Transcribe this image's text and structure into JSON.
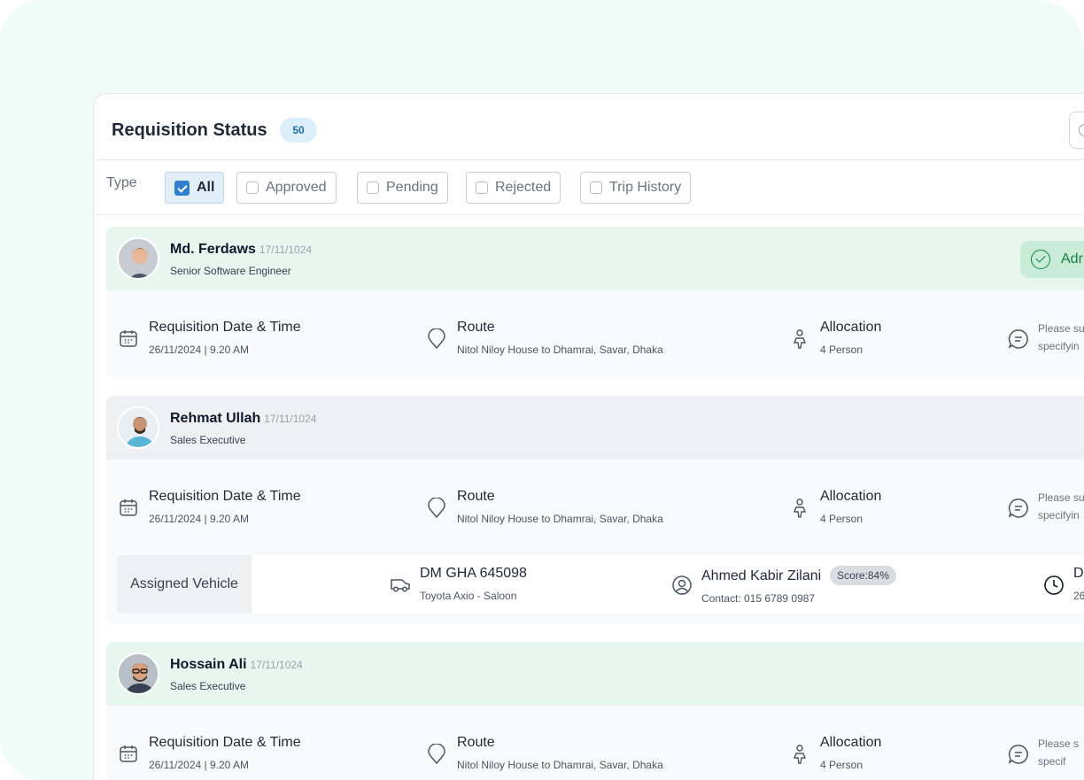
{
  "header": {
    "title": "Requisition Status",
    "count": "50"
  },
  "filters": {
    "type_label": "Type",
    "chips": [
      {
        "label": "All",
        "checked": true
      },
      {
        "label": "Approved",
        "checked": false
      },
      {
        "label": "Pending",
        "checked": false
      },
      {
        "label": "Rejected",
        "checked": false
      },
      {
        "label": "Trip History",
        "checked": false
      }
    ]
  },
  "labels": {
    "req_date": "Requisition Date & Time",
    "route": "Route",
    "allocation": "Allocation",
    "assigned_vehicle": "Assigned Vehicle"
  },
  "requisitions": [
    {
      "name": "Md. Ferdaws",
      "date": "17/11/1024",
      "role": "Senior Software Engineer",
      "status": "Adr",
      "header_color": "#e7f6ef",
      "req_datetime": "26/11/2024 | 9.20 AM",
      "route": "Nitol Niloy House to Dhamrai, Savar, Dhaka",
      "allocation": "4 Person",
      "note_line1": "Please su",
      "note_line2": "specifyin"
    },
    {
      "name": "Rehmat Ullah",
      "date": "17/11/1024",
      "role": "Sales Executive",
      "header_color": "#eef0f2",
      "req_datetime": "26/11/2024 | 9.20 AM",
      "route": "Nitol Niloy House to Dhamrai, Savar, Dhaka",
      "allocation": "4 Person",
      "note_line1": "Please su",
      "note_line2": "specifyin",
      "vehicle": {
        "plate": "DM GHA 645098",
        "model": "Toyota Axio - Saloon",
        "driver": "Ahmed Kabir Zilani",
        "score": "Score:84%",
        "contact": "Contact: 015 6789 0987",
        "time_label": "D",
        "time_value": "26"
      }
    },
    {
      "name": "Hossain Ali",
      "date": "17/11/1024",
      "role": "Sales Executive",
      "header_color": "#e7f6ef",
      "req_datetime": "26/11/2024 | 9.20 AM",
      "route": "Nitol Niloy House to Dhamrai, Savar, Dhaka",
      "allocation": "4 Person",
      "note_line1": "Please s",
      "note_line2": "specif"
    }
  ]
}
